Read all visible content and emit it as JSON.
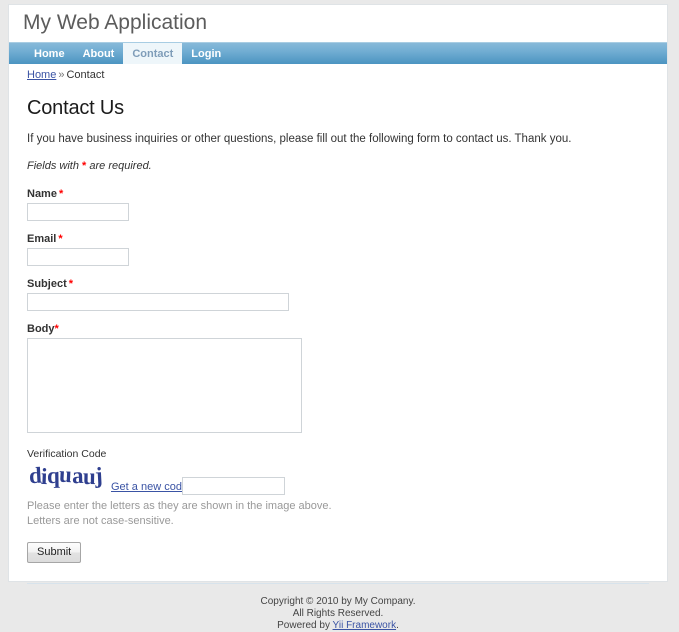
{
  "header": {
    "logo": "My Web Application"
  },
  "mainmenu": {
    "items": [
      {
        "label": "Home",
        "active": false
      },
      {
        "label": "About",
        "active": false
      },
      {
        "label": "Contact",
        "active": true
      },
      {
        "label": "Login",
        "active": false
      }
    ]
  },
  "breadcrumb": {
    "home_label": "Home",
    "separator": "»",
    "current": "Contact"
  },
  "content": {
    "title": "Contact Us",
    "intro": "If you have business inquiries or other questions, please fill out the following form to contact us. Thank you.",
    "note_prefix": "Fields with ",
    "note_star": "*",
    "note_suffix": " are required."
  },
  "form": {
    "name": {
      "label": "Name",
      "required_mark": "*",
      "value": "",
      "placeholder": ""
    },
    "email": {
      "label": "Email",
      "required_mark": "*",
      "value": "",
      "placeholder": ""
    },
    "subject": {
      "label": "Subject",
      "required_mark": "*",
      "value": "",
      "placeholder": ""
    },
    "body": {
      "label": "Body",
      "required_mark": "*",
      "value": "",
      "placeholder": ""
    },
    "verification": {
      "label": "Verification Code",
      "captcha_text": "diquauj",
      "refresh_label": "Get a new code",
      "value": "",
      "placeholder": "",
      "hint_line1": "Please enter the letters as they are shown in the image above.",
      "hint_line2": "Letters are not case-sensitive."
    },
    "submit_label": "Submit"
  },
  "footer": {
    "line1": "Copyright © 2010 by My Company.",
    "line2": "All Rights Reserved.",
    "powered_prefix": "Powered by ",
    "powered_link": "Yii Framework",
    "powered_suffix": "."
  },
  "colors": {
    "nav_top": "#87b9d9",
    "nav_bottom": "#4b94c1",
    "active_tab_bg": "#eef6fa",
    "active_tab_text": "#7f9db9",
    "link": "#3a53a4",
    "required": "#ff0000",
    "captcha": "#2f3f8f",
    "page_bg": "#e9e9e9"
  }
}
